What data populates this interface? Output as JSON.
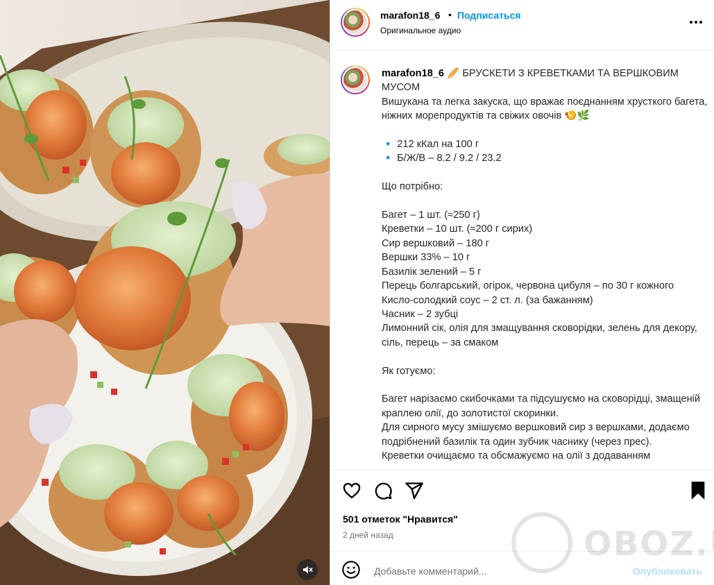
{
  "post": {
    "username": "marafon18_6",
    "dot": "•",
    "follow_label": "Подписаться",
    "audio_label": "Оригинальное аудио"
  },
  "caption": {
    "username": "marafon18_6",
    "text": "🥖 БРУСКЕТИ З КРЕВЕТКАМИ ТА ВЕРШКОВИМ МУСОМ\nВишукана та легка закуска, що вражає поєднанням хрусткого багета, ніжних морепродуктів та свіжих овочів 🍤🌿\n\n🔹 212 кКал на 100 г\n🔹 Б/Ж/В – 8.2 / 9.2 / 23.2\n\nЩо потрібно:\n\nБагет – 1 шт. (≈250 г)\nКреветки – 10 шт. (≈200 г сирих)\nСир вершковий – 180 г\nВершки 33% – 10 г\nБазилік зелений – 5 г\nПерець болгарський, огірок, червона цибуля – по 30 г кожного\nКисло-солодкий соус – 2 ст. л. (за бажанням)\nЧасник – 2 зубці\nЛимонний сік, олія для змащування сковорідки, зелень для декору, сіль, перець – за смаком\n\nЯк готуємо:\n\nБагет нарізаємо скибочками та підсушуємо на сковорідці, змащеній краплею олії, до золотистої скоринки.\nДля сирного мусу змішуємо вершковий сир з вершками, додаємо подрібнений базилік та один зубчик часнику (через прес).\nКреветки очищаємо та обсмажуємо на олії з додаванням"
  },
  "actions": {
    "likes_label": "501 отметок \"Нравится\"",
    "time_label": "2 дней назад"
  },
  "comment": {
    "placeholder": "Добавьте комментарий...",
    "publish_label": "Опубликовать"
  },
  "watermark": {
    "text": "OBOZ.UA"
  },
  "icons": {
    "like": "heart-icon",
    "comment": "comment-icon",
    "share": "share-icon",
    "save": "bookmark-icon",
    "more": "more-icon",
    "emoji": "emoji-icon",
    "mute": "muted-speaker-icon"
  },
  "colors": {
    "accent": "#0095f6",
    "publish_disabled": "#b2dffc",
    "muted_text": "#737373"
  }
}
